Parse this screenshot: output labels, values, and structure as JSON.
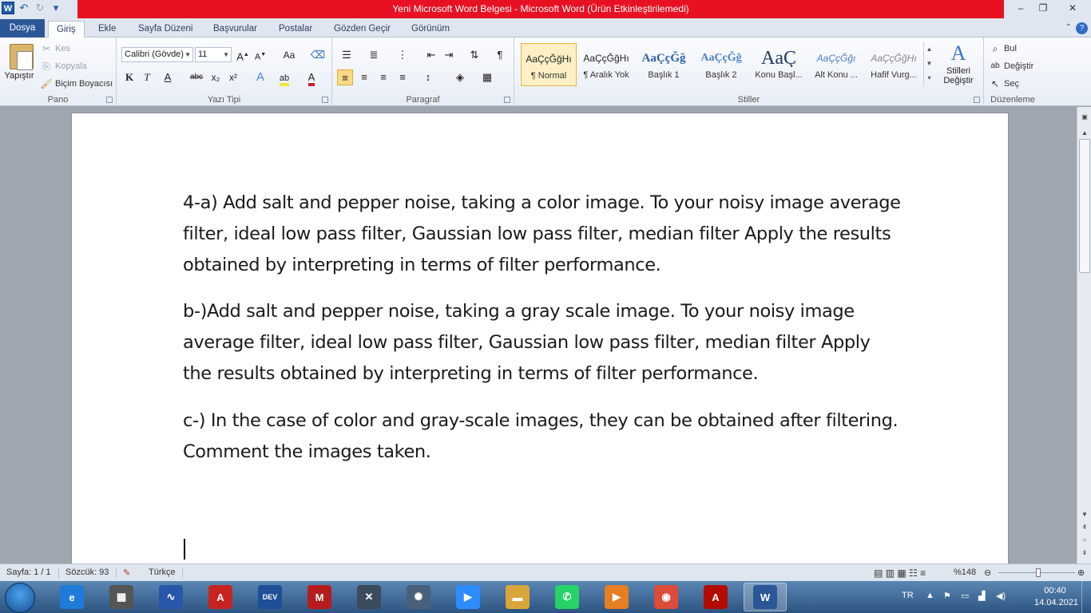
{
  "window": {
    "title": "Yeni Microsoft Word Belgesi  -  Microsoft Word (Ürün Etkinleştirilemedi)",
    "minimize": "‒",
    "maximize": "❐",
    "close": "✕"
  },
  "quick_access": {
    "app_letter": "W",
    "undo": "↶",
    "redo": "↻",
    "customize": "▾"
  },
  "tabs": [
    {
      "label": "Dosya"
    },
    {
      "label": "Giriş"
    },
    {
      "label": "Ekle"
    },
    {
      "label": "Sayfa Düzeni"
    },
    {
      "label": "Başvurular"
    },
    {
      "label": "Postalar"
    },
    {
      "label": "Gözden Geçir"
    },
    {
      "label": "Görünüm"
    }
  ],
  "ribbon": {
    "clipboard": {
      "group_label": "Pano",
      "paste": "Yapıştır",
      "cut": "Kes",
      "copy": "Kopyala",
      "format_painter": "Biçim Boyacısı"
    },
    "font": {
      "group_label": "Yazı Tipi",
      "font_name": "Calibri (Gövde)",
      "font_size": "11",
      "bold": "K",
      "italic": "T",
      "underline": "A",
      "strike": "abc",
      "subscript": "x₂",
      "superscript": "x²",
      "grow": "A",
      "shrink": "A",
      "change_case": "Aa",
      "font_color_accent": "#d0202a",
      "highlight_accent": "#f4e534"
    },
    "paragraph": {
      "group_label": "Paragraf",
      "show_marks": "¶"
    },
    "styles": {
      "group_label": "Stiller",
      "items": [
        {
          "sample": "AaÇçĞğHı",
          "name": "¶ Normal"
        },
        {
          "sample": "AaÇçĞğHı",
          "name": "¶ Aralık Yok"
        },
        {
          "sample": "AaÇçĞğ",
          "name": "Başlık 1"
        },
        {
          "sample": "AaÇçĞğ",
          "name": "Başlık 2"
        },
        {
          "sample": "AaÇ",
          "name": "Konu Başl..."
        },
        {
          "sample": "AaÇçĞğı",
          "name": "Alt Konu ..."
        },
        {
          "sample": "AaÇçĞğHı",
          "name": "Hafif Vurg..."
        }
      ],
      "change_styles": "Stilleri Değiştir"
    },
    "editing": {
      "group_label": "Düzenleme",
      "find": "Bul",
      "replace": "Değiştir",
      "select": "Seç"
    }
  },
  "document": {
    "paragraphs": [
      "4-a)  Add salt and pepper noise, taking a color image. To your noisy image average filter, ideal low pass filter, Gaussian low pass filter, median filter Apply the results obtained by interpreting in terms of filter performance.",
      "b-)Add salt and pepper noise, taking a gray scale image. To your noisy image average filter, ideal low pass filter, Gaussian low pass filter, median filter Apply the results obtained by interpreting in terms of filter performance.",
      "c-) In the case of color and gray-scale images, they can be obtained after filtering. Comment the images taken."
    ]
  },
  "status": {
    "page": "Sayfa: 1 / 1",
    "words": "Sözcük: 93",
    "language": "Türkçe",
    "zoom": "%148"
  },
  "taskbar": {
    "items": [
      {
        "name": "internet-explorer-icon",
        "glyph": "e",
        "color": "#1e7bd8"
      },
      {
        "name": "chip-icon",
        "glyph": "▦",
        "color": "#555555"
      },
      {
        "name": "proteus-icon",
        "glyph": "∿",
        "color": "#2856a8"
      },
      {
        "name": "autocad-icon",
        "glyph": "A",
        "color": "#c8241f"
      },
      {
        "name": "devc-icon",
        "glyph": "DEV",
        "color": "#1f4f96"
      },
      {
        "name": "mplab-icon",
        "glyph": "M",
        "color": "#b71c1c"
      },
      {
        "name": "x-app-icon",
        "glyph": "✕",
        "color": "#3b4a5c"
      },
      {
        "name": "atom-icon",
        "glyph": "✺",
        "color": "#49607a"
      },
      {
        "name": "zoom-icon",
        "glyph": "▶",
        "color": "#2d8cff"
      },
      {
        "name": "file-explorer-icon",
        "glyph": "▬",
        "color": "#d9a63a"
      },
      {
        "name": "whatsapp-icon",
        "glyph": "✆",
        "color": "#25d366"
      },
      {
        "name": "media-player-icon",
        "glyph": "▶",
        "color": "#e67e22"
      },
      {
        "name": "chrome-icon",
        "glyph": "◉",
        "color": "#dd4b39"
      },
      {
        "name": "acrobat-icon",
        "glyph": "A",
        "color": "#b30b00"
      },
      {
        "name": "word-icon",
        "glyph": "W",
        "color": "#2b5797"
      }
    ],
    "lang": "TR",
    "time": "00:40",
    "date": "14.04.2021"
  }
}
